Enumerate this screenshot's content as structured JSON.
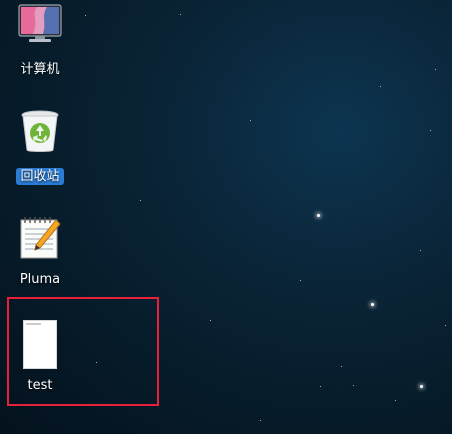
{
  "desktop": {
    "icons": [
      {
        "label": "计算机",
        "icon": "computer-icon",
        "selected": false
      },
      {
        "label": "回收站",
        "icon": "trash-icon",
        "selected": true
      },
      {
        "label": "Pluma",
        "icon": "text-editor-icon",
        "selected": false
      },
      {
        "label": "test",
        "icon": "blank-document-icon",
        "selected": false
      }
    ]
  },
  "colors": {
    "selection_highlight": "#2a7cd6",
    "focus_box": "#e8203a"
  }
}
